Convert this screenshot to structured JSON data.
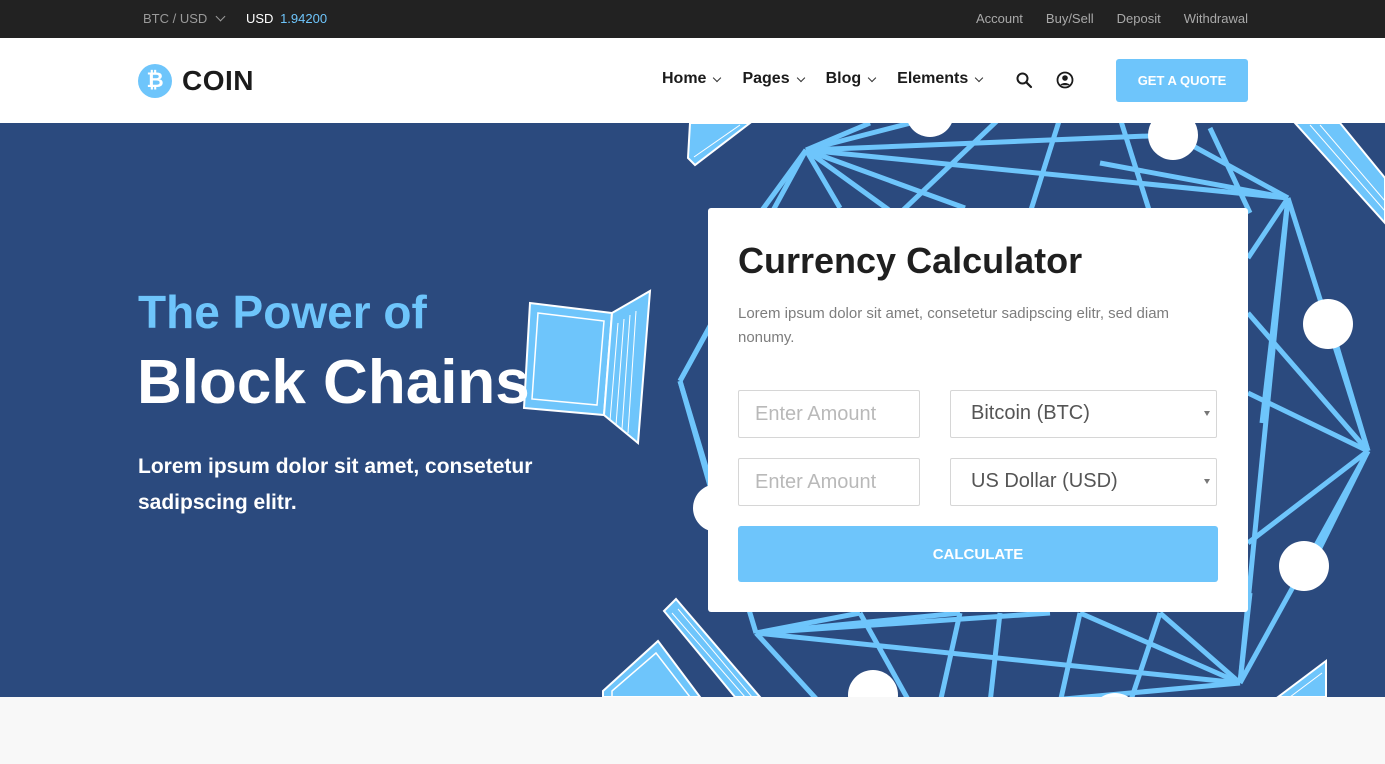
{
  "topbar": {
    "pair_label": "BTC / USD",
    "price_currency": "USD",
    "price_value": "1.94200",
    "links": [
      "Account",
      "Buy/Sell",
      "Deposit",
      "Withdrawal"
    ]
  },
  "header": {
    "logo_text": "COIN",
    "nav": [
      "Home",
      "Pages",
      "Blog",
      "Elements"
    ],
    "cta_label": "GET A QUOTE"
  },
  "hero": {
    "subtitle": "The Power of",
    "title": "Block Chains",
    "text": "Lorem ipsum dolor sit amet, consetetur sadipscing elitr."
  },
  "calculator": {
    "title": "Currency Calculator",
    "description": "Lorem ipsum dolor sit amet, consetetur sadipscing elitr, sed diam nonumy.",
    "amount_placeholder_1": "Enter Amount",
    "amount_placeholder_2": "Enter Amount",
    "currency_1": "Bitcoin (BTC)",
    "currency_2": "US Dollar (USD)",
    "button_label": "CALCULATE"
  },
  "colors": {
    "accent": "#6ec5fb",
    "hero_bg": "#2b4a7e",
    "topbar_bg": "#222222"
  },
  "icons": [
    "bitcoin-logo-icon",
    "search-icon",
    "user-icon",
    "chevron-down-icon"
  ]
}
